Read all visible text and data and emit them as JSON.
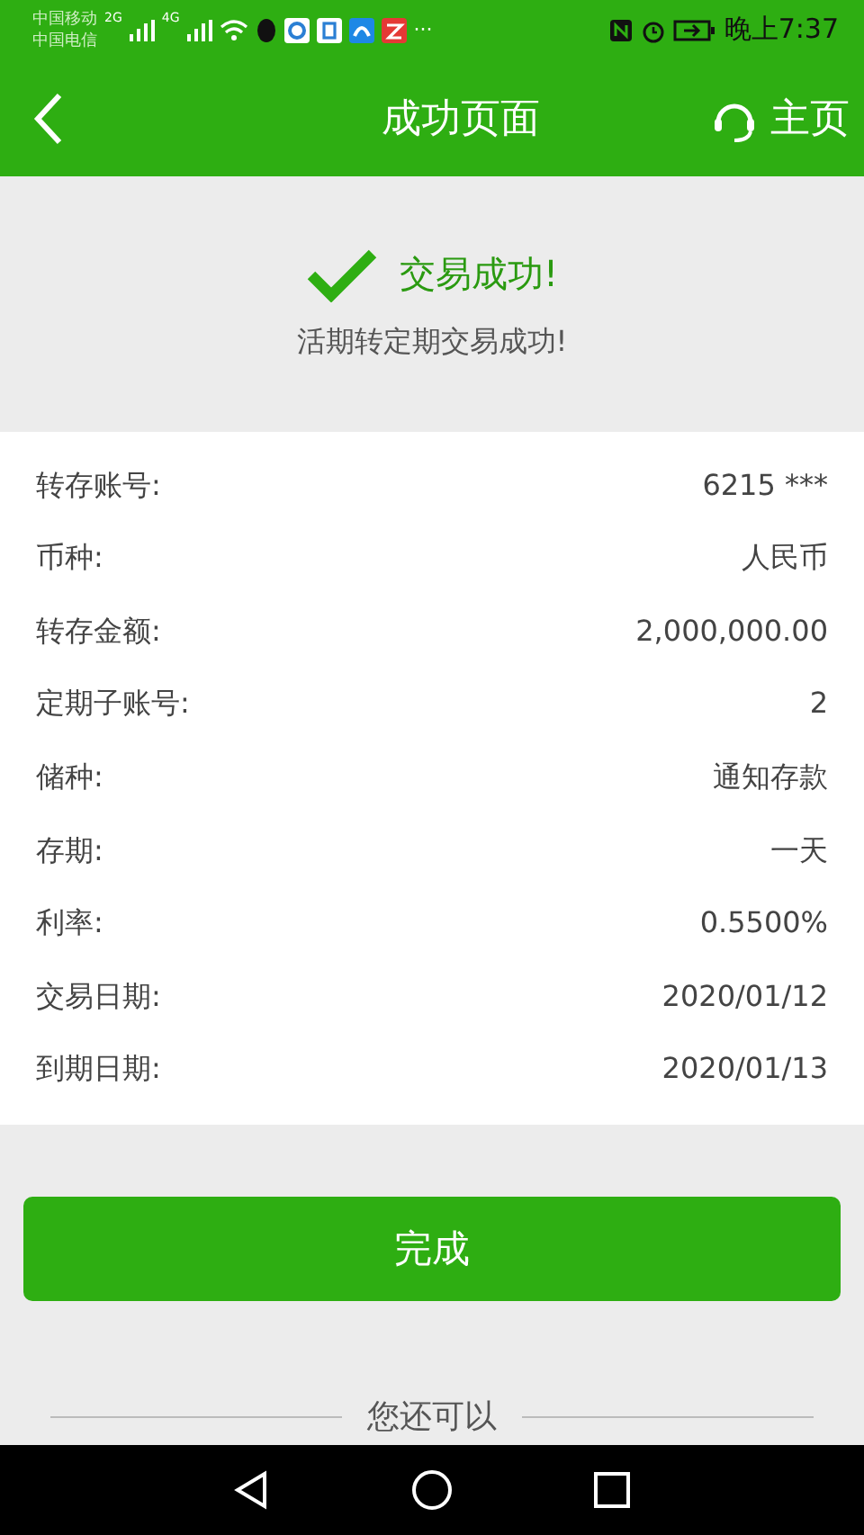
{
  "status_bar": {
    "carriers": [
      "中国移动",
      "中国电信"
    ],
    "networks": [
      "2G",
      "4G"
    ],
    "more": "···",
    "time": "晚上7:37"
  },
  "header": {
    "title": "成功页面",
    "home": "主页"
  },
  "result": {
    "title": "交易成功!",
    "message": "活期转定期交易成功!"
  },
  "details": [
    {
      "label": "转存账号:",
      "value": "6215 ***"
    },
    {
      "label": "币种:",
      "value": "人民币"
    },
    {
      "label": "转存金额:",
      "value": "2,000,000.00"
    },
    {
      "label": "定期子账号:",
      "value": "2"
    },
    {
      "label": "储种:",
      "value": "通知存款"
    },
    {
      "label": "存期:",
      "value": "一天"
    },
    {
      "label": "利率:",
      "value": "0.5500%"
    },
    {
      "label": "交易日期:",
      "value": "2020/01/12"
    },
    {
      "label": "到期日期:",
      "value": "2020/01/13"
    }
  ],
  "done_button": "完成",
  "more_section": "您还可以"
}
